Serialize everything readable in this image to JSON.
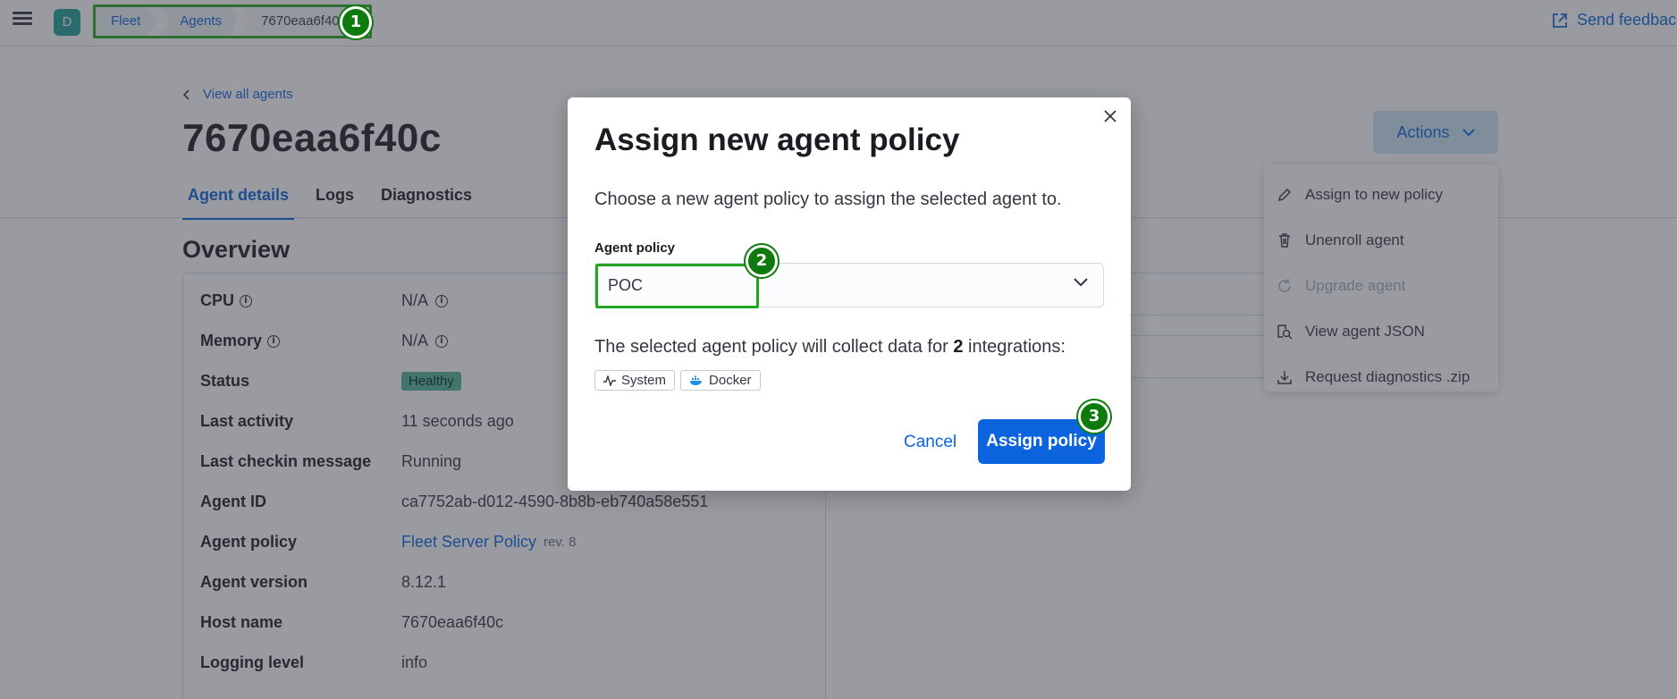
{
  "header": {
    "avatar_letter": "D",
    "breadcrumbs": [
      "Fleet",
      "Agents",
      "7670eaa6f40c"
    ],
    "feedback_label": "Send feedback"
  },
  "page": {
    "back_link": "View all agents",
    "title": "7670eaa6f40c",
    "tabs": [
      "Agent details",
      "Logs",
      "Diagnostics"
    ],
    "section_title": "Overview",
    "rows": [
      {
        "key": "CPU",
        "value": "N/A"
      },
      {
        "key": "Memory",
        "value": "N/A"
      },
      {
        "key": "Status",
        "value": "Healthy"
      },
      {
        "key": "Last activity",
        "value": "11 seconds ago"
      },
      {
        "key": "Last checkin message",
        "value": "Running"
      },
      {
        "key": "Agent ID",
        "value": "ca7752ab-d012-4590-8b8b-eb740a58e551"
      },
      {
        "key": "Agent policy",
        "value": "Fleet Server Policy",
        "extra": "rev. 8"
      },
      {
        "key": "Agent version",
        "value": "8.12.1"
      },
      {
        "key": "Host name",
        "value": "7670eaa6f40c"
      },
      {
        "key": "Logging level",
        "value": "info"
      }
    ]
  },
  "actions": {
    "button_label": "Actions",
    "menu": [
      {
        "label": "Assign to new policy",
        "icon": "pencil-icon",
        "disabled": false
      },
      {
        "label": "Unenroll agent",
        "icon": "trash-icon",
        "disabled": false
      },
      {
        "label": "Upgrade agent",
        "icon": "refresh-icon",
        "disabled": true
      },
      {
        "label": "View agent JSON",
        "icon": "inspect-icon",
        "disabled": false
      },
      {
        "label": "Request diagnostics .zip",
        "icon": "download-icon",
        "disabled": false
      }
    ]
  },
  "modal": {
    "title": "Assign new agent policy",
    "description": "Choose a new agent policy to assign the selected agent to.",
    "field_label": "Agent policy",
    "selected_policy": "POC",
    "collect_prefix": "The selected agent policy will collect data for",
    "integration_count": "2",
    "collect_suffix": "integrations:",
    "integrations": [
      "System",
      "Docker"
    ],
    "cancel_label": "Cancel",
    "assign_label": "Assign policy"
  },
  "steps": [
    "1",
    "2",
    "3"
  ],
  "colors": {
    "accent": "#0b64dd",
    "highlight": "#23a623",
    "step_marker": "#0c7a0c",
    "healthy_badge": "#54b399"
  }
}
